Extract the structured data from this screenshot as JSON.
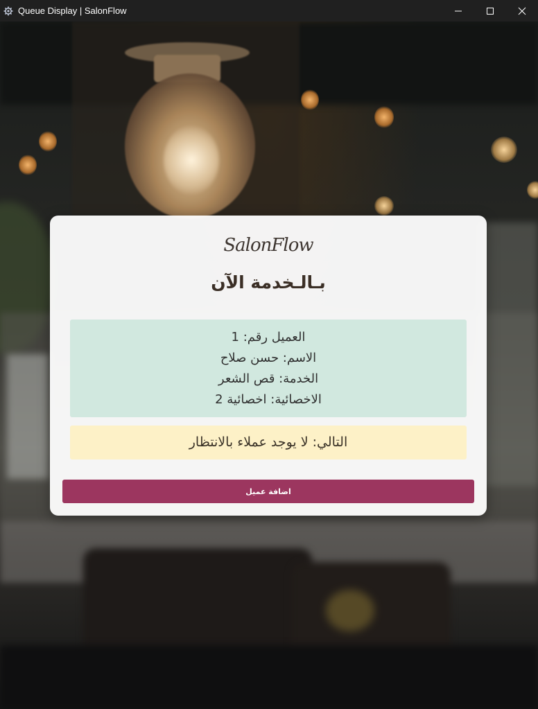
{
  "window": {
    "title": "Queue Display | SalonFlow",
    "app_icon": "gear-app-icon",
    "controls": [
      "minimize-icon",
      "maximize-icon",
      "close-icon"
    ]
  },
  "card": {
    "logo": "SalonFlow",
    "heading": "بـالـخدمة الآن",
    "current": {
      "customer_number": "العميل رقم: 1",
      "name": "الاسم: حسن صلاح",
      "service": "الخدمة: قص الشعر",
      "specialist": "الاخصائية: اخصائية 2"
    },
    "next": "التالي: لا يوجد عملاء بالانتظار",
    "add_button": "اضافة عميل"
  },
  "colors": {
    "current_bg": "#d1e8df",
    "next_bg": "#fdf1c7",
    "button_bg": "#9c365f",
    "titlebar_bg": "#202020"
  }
}
